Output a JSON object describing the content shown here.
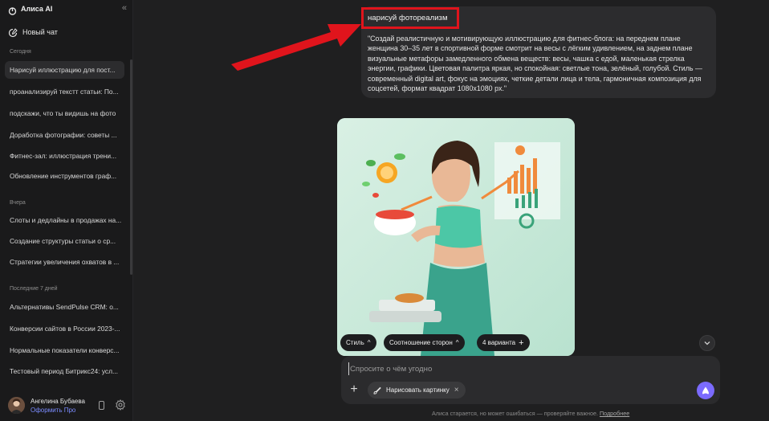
{
  "app": {
    "title": "Алиса AI",
    "accent": "#7b6bff",
    "highlight": "#e0141c"
  },
  "sidebar": {
    "new_chat": "Новый чат",
    "sections": [
      {
        "label": "Сегодня",
        "items": [
          {
            "label": "Нарисуй иллюстрацию для пост...",
            "active": true
          },
          {
            "label": "проанализируй текстт статьи: По..."
          },
          {
            "label": "подскажи, что ты видишь на фото"
          },
          {
            "label": "Доработка фотографии: советы ..."
          },
          {
            "label": "Фитнес-зал: иллюстрация трени..."
          },
          {
            "label": "Обновление инструментов граф..."
          }
        ]
      },
      {
        "label": "Вчера",
        "items": [
          {
            "label": "Слоты и дедлайны в продажах на..."
          },
          {
            "label": "Создание структуры статьи о ср..."
          },
          {
            "label": "Стратегии увеличения охватов в ..."
          }
        ]
      },
      {
        "label": "Последние 7 дней",
        "items": [
          {
            "label": "Альтернативы SendPulse CRM: о..."
          },
          {
            "label": "Конверсии сайтов в России 2023-..."
          },
          {
            "label": "Нормальные показатели конверс..."
          },
          {
            "label": "Тестовый период Битрикс24: усл..."
          }
        ]
      }
    ],
    "profile": {
      "name": "Ангелина Бубаева",
      "pro_link": "Оформить Про"
    }
  },
  "conversation": {
    "user_message": {
      "title": "нарисуй фотореализм",
      "body": "\"Создай реалистичную и мотивирующую иллюстрацию для фитнес-блога: на переднем плане женщина 30–35 лет в спортивной форме смотрит на весы с лёгким удивлением, на заднем плане визуальные метафоры замедленного обмена веществ: весы, чашка с едой, маленькая стрелка энергии, графики. Цветовая палитра яркая, но спокойная: светлые тона, зелёный, голубой. Стиль — современный digital art, фокус на эмоциях, четкие детали лица и тела, гармоничная композиция для соцсетей, формат квадрат 1080x1080 px.\""
    },
    "image_controls": {
      "style": "Стиль",
      "aspect": "Соотношение сторон",
      "variants": "4 варианта"
    }
  },
  "composer": {
    "placeholder": "Спросите о чём угодно",
    "draw_chip": "Нарисовать картинку"
  },
  "footer": {
    "note": "Алиса старается, но может ошибаться — проверяйте важное.",
    "link": "Подробнее"
  }
}
